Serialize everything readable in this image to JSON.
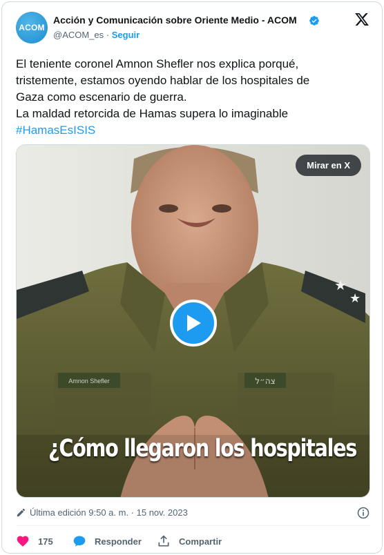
{
  "author": {
    "avatar_text": "ACOM",
    "display_name": "Acción y Comunicación sobre Oriente Medio - ACOM",
    "handle": "@ACOM_es",
    "separator": "·",
    "follow_label": "Seguir"
  },
  "tweet": {
    "lines": [
      "El teniente coronel Amnon Shefler nos explica porqué,",
      "tristemente, estamos oyendo hablar de los hospitales de",
      "Gaza como escenario de guerra.",
      "La maldad retorcida de Hamas supera lo imaginable"
    ],
    "hashtag": "#HamasEsISIS"
  },
  "media": {
    "watch_label": "Mirar en X",
    "caption": "¿Cómo llegaron los hospitales",
    "name_tag": "Amnon Shefler",
    "hebrew_tag": "צה״ל"
  },
  "meta": {
    "edited_text": "Última edición 9:50 a. m. · 15 nov. 2023"
  },
  "actions": {
    "likes_count": "175",
    "reply_label": "Responder",
    "share_label": "Compartir"
  },
  "colors": {
    "accent": "#1d9bf0",
    "like": "#f91880",
    "text": "#0f1419",
    "secondary": "#536471"
  }
}
